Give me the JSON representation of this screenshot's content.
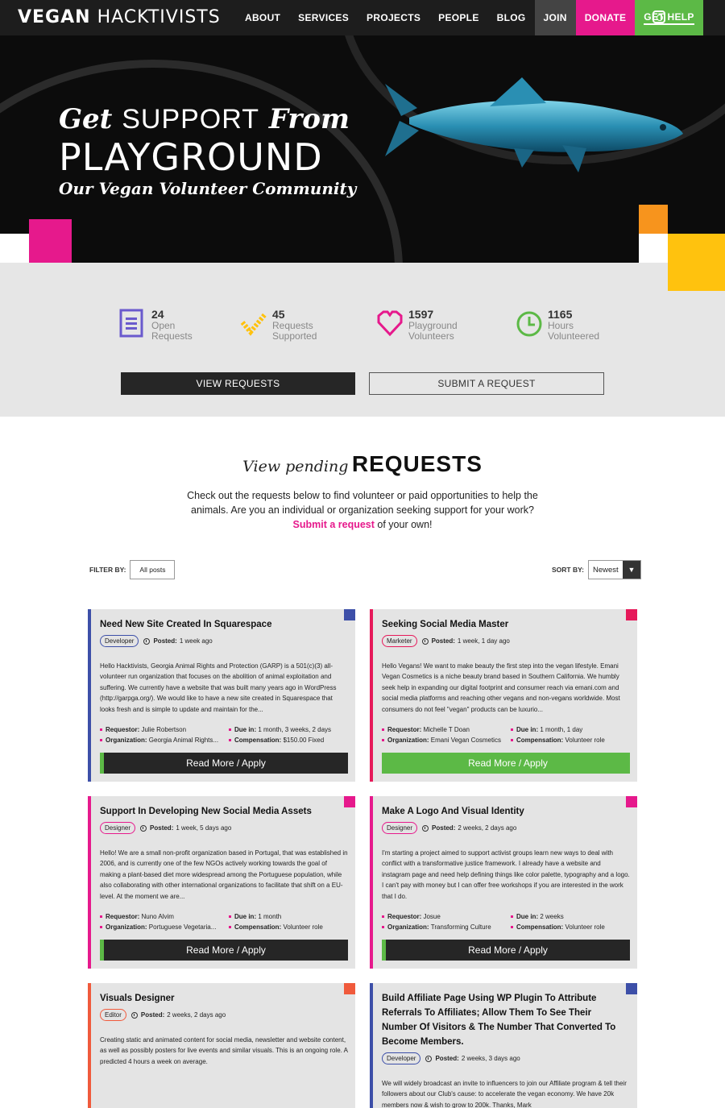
{
  "nav": {
    "logo_bold": "VEGAN",
    "logo_light": "HACKTIVISTS",
    "items": [
      "ABOUT",
      "SERVICES",
      "PROJECTS",
      "PEOPLE",
      "BLOG",
      "JOIN",
      "DONATE",
      "GET HELP"
    ]
  },
  "hero": {
    "line1_a": "Get",
    "line1_b": "SUPPORT",
    "line1_c": "From",
    "line2": "PLAYGROUND",
    "line3": "Our Vegan Volunteer Community"
  },
  "stats": [
    {
      "num": "24",
      "label": "Open Requests"
    },
    {
      "num": "45",
      "label": "Requests Supported"
    },
    {
      "num": "1597",
      "label": "Playground Volunteers"
    },
    {
      "num": "1165",
      "label": "Hours Volunteered"
    }
  ],
  "buttons": {
    "view": "VIEW REQUESTS",
    "submit": "SUBMIT A REQUEST"
  },
  "requests": {
    "title_italic": "View pending",
    "title_big": "REQUESTS",
    "desc_before": "Check out the requests below to find volunteer or paid opportunities to help the animals. Are you an individual or organization seeking support for your work?",
    "desc_link": "Submit a request",
    "desc_after": "of your own!",
    "filter_label": "FILTER BY:",
    "filter_value": "All posts",
    "sort_label": "SORT BY:",
    "sort_value": "Newest"
  },
  "labels": {
    "posted": "Posted:",
    "requestor": "Requestor:",
    "due": "Due in:",
    "organization": "Organization:",
    "compensation": "Compensation:"
  },
  "cards": [
    {
      "title": "Need New Site Created In Squarespace",
      "tag": "Developer",
      "posted": "1 week ago",
      "body": "Hello Hacktivists, Georgia Animal Rights and Protection (GARP) is a 501(c)(3) all-volunteer run organization that focuses on the abolition of animal exploitation and suffering. We currently have a website that was built many years ago in WordPress (http://garpga.org/). We would like to have a new site created in Squarespace that looks fresh and is simple to update and maintain for the...",
      "requestor": "Julie Robertson",
      "due": "1 month, 3 weeks, 2 days",
      "organization": "Georgia Animal Rights...",
      "compensation": "$150.00 Fixed",
      "button": "Read More / Apply",
      "accent": "#3d4fa8"
    },
    {
      "title": "Seeking Social Media Master",
      "tag": "Marketer",
      "posted": "1 week, 1 day ago",
      "body": "Hello Vegans! We want to make beauty the first step into the vegan lifestyle. Emani Vegan Cosmetics is a niche beauty brand based in Southern California. We humbly seek help in expanding our digital footprint and consumer reach via emani.com and social media platforms and reaching other vegans and non-vegans worldwide. Most consumers do not feel \"vegan\" products can be luxurio...",
      "requestor": "Michelle T Doan",
      "due": "1 month, 1 day",
      "organization": "Emani Vegan Cosmetics",
      "compensation": "Volunteer role",
      "button": "Read More / Apply",
      "accent": "#e6195a"
    },
    {
      "title": "Support In Developing New Social Media Assets",
      "tag": "Designer",
      "posted": "1 week, 5 days ago",
      "body": "Hello! We are a small non-profit organization based in Portugal, that was established in 2006, and is currently one of the few NGOs actively working towards the goal of making a plant-based diet more widespread among the Portuguese population, while also collaborating with other international organizations to facilitate that shift on a EU-level. At the moment we are...",
      "requestor": "Nuno Alvim",
      "due": "1 month",
      "organization": "Portuguese Vegetaria...",
      "compensation": "Volunteer role",
      "button": "Read More / Apply",
      "accent": "#e6198c"
    },
    {
      "title": "Make A Logo And Visual Identity",
      "tag": "Designer",
      "posted": "2 weeks, 2 days ago",
      "body": "I'm starting a project aimed to support activist groups learn new ways to deal with conflict with a transformative justice framework. I already have a website and instagram page and need help defining things like color palette, typography and a logo. I can't pay with money but I can offer free workshops if you are interested in the work that I do.",
      "requestor": "Josue",
      "due": "2 weeks",
      "organization": "Transforming Culture",
      "compensation": "Volunteer role",
      "button": "Read More / Apply",
      "accent": "#e6198c"
    },
    {
      "title": "Visuals Designer",
      "tag": "Editor",
      "posted": "2 weeks, 2 days ago",
      "body": "Creating static and animated content for social media, newsletter and website content, as well as possibly posters for live events and similar visuals. This is an ongoing role. A predicted 4 hours a week on average.",
      "accent": "#f05a3c"
    },
    {
      "title": "Build Affiliate Page Using WP Plugin To Attribute Referrals To Affiliates; Allow Them To See Their Number Of Visitors & The Number That Converted To Become Members.",
      "tag": "Developer",
      "posted": "2 weeks, 3 days ago",
      "body": "We will widely broadcast an invite to influencers to join our Affiliate program & tell their followers about our Club's cause: to accelerate the vegan economy. We have 20k members now & wish to grow to 200k. Thanks, Mark",
      "accent": "#3d4fa8"
    }
  ],
  "colors": {
    "pink": "#e6198c",
    "green": "#5cb946",
    "blue": "#3d4fa8",
    "orange": "#f05a3c",
    "yellow": "#ffc20e",
    "dark": "#1d1d1d"
  }
}
